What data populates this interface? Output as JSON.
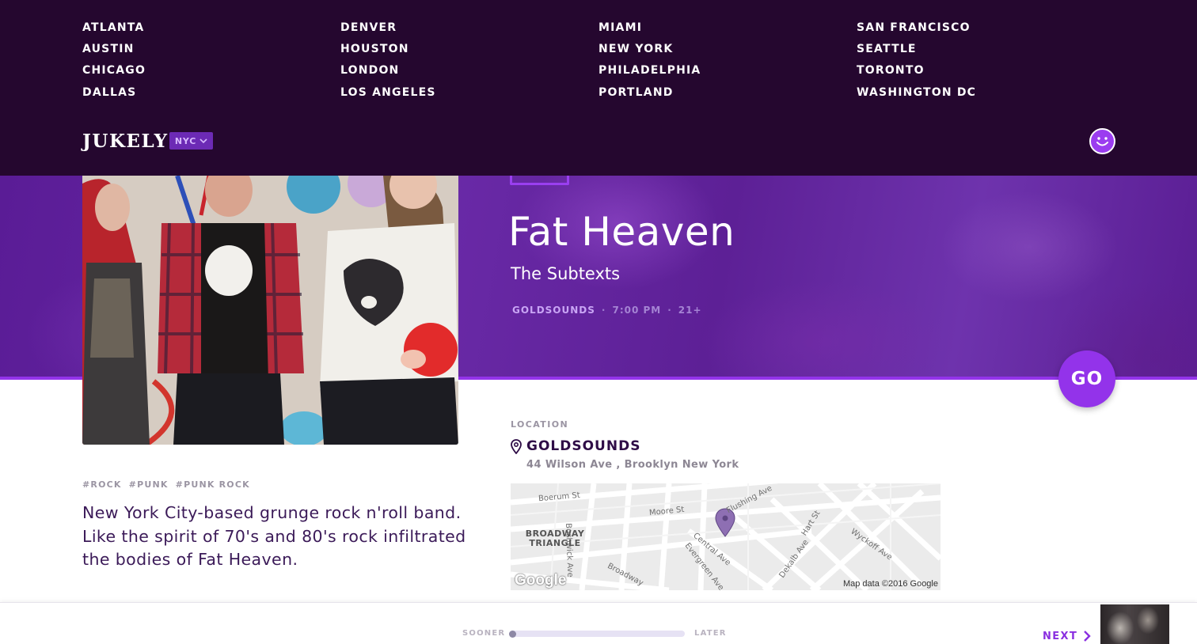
{
  "header": {
    "city_columns": [
      [
        "ATLANTA",
        "AUSTIN",
        "CHICAGO",
        "DALLAS"
      ],
      [
        "DENVER",
        "HOUSTON",
        "LONDON",
        "LOS ANGELES"
      ],
      [
        "MIAMI",
        "NEW YORK",
        "PHILADELPHIA",
        "PORTLAND"
      ],
      [
        "SAN FRANCISCO",
        "SEATTLE",
        "TORONTO",
        "WASHINGTON DC"
      ]
    ],
    "logo": "JUKELY",
    "city_select": "NYC",
    "profile_icon": "smiley-face-icon"
  },
  "event": {
    "title": "Fat Heaven",
    "support": "The Subtexts",
    "venue": "GOLDSOUNDS",
    "separator": "·",
    "time": "7:00 PM",
    "age": "21+",
    "go_label": "GO"
  },
  "details": {
    "tags": [
      "#ROCK",
      "#PUNK",
      "#PUNK ROCK"
    ],
    "description": "New York City-based grunge rock n'roll band. Like the spirit of 70's and 80's rock infiltrated the bodies of Fat Heaven."
  },
  "location": {
    "label": "LOCATION",
    "venue": "GOLDSOUNDS",
    "address": "44 Wilson Ave , Brooklyn New York",
    "map": {
      "streets": [
        "Boerum St",
        "Moore St",
        "Flushing Ave",
        "Central Ave",
        "Evergreen Ave",
        "Broadway",
        "Hart St",
        "Dekalb Ave",
        "Wyckoff Ave",
        "Bushwick Ave"
      ],
      "area": "BROADWAY TRIANGLE",
      "attribution": "Map data ©2016 Google",
      "provider": "Google"
    }
  },
  "bottom_bar": {
    "sooner_label": "SOONER",
    "later_label": "LATER",
    "slider_position": 0,
    "next_label": "NEXT"
  },
  "colors": {
    "header_bg": "#25072f",
    "accent": "#9333ea",
    "hero_purple": "#5a1c96",
    "text_dark_purple": "#3b1a58"
  }
}
